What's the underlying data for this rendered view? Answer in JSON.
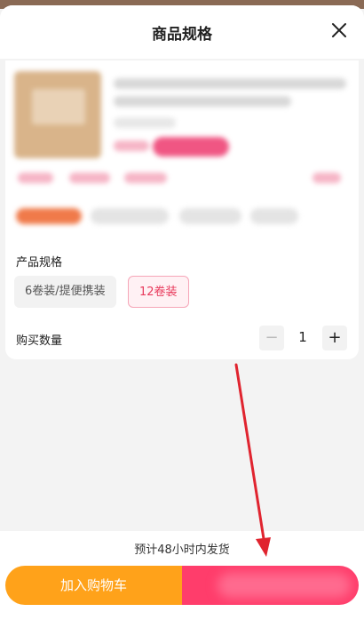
{
  "dialog": {
    "title": "商品规格",
    "close_icon": "close-icon"
  },
  "spec": {
    "section_label": "产品规格",
    "options": [
      {
        "label": "6卷装/提便携装",
        "selected": false
      },
      {
        "label": "12卷装",
        "selected": true
      }
    ]
  },
  "quantity": {
    "label": "购买数量",
    "value": "1",
    "minus_symbol": "−",
    "plus_symbol": "+"
  },
  "footer": {
    "shipping_note": "预计48小时内发货",
    "add_to_cart_label": "加入购物车"
  },
  "colors": {
    "accent_pink": "#ff3d6b",
    "cart_orange": "#ffa21a",
    "annotation_red": "#e0242f"
  }
}
